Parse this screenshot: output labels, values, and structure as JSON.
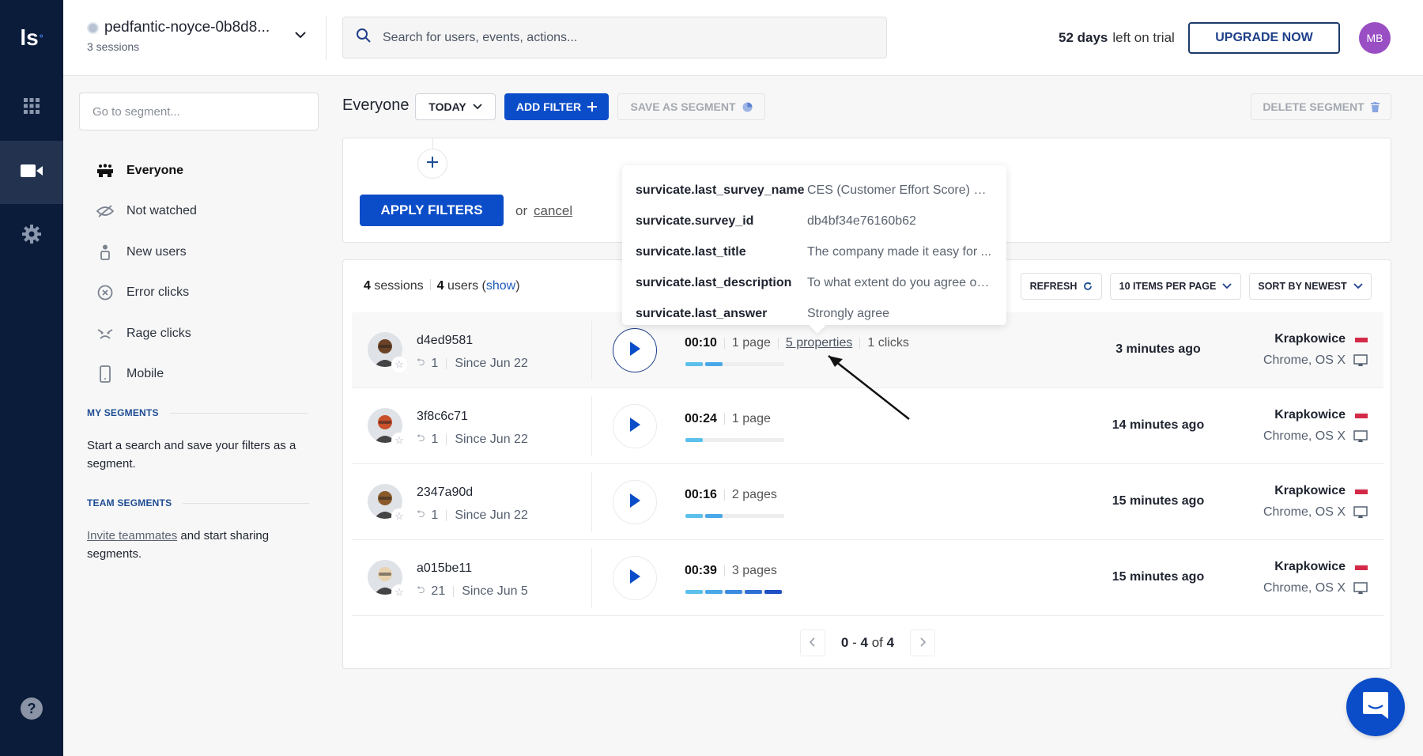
{
  "rail": {
    "logo": "ls",
    "items": [
      {
        "name": "apps",
        "icon": "grid-icon"
      },
      {
        "name": "sessions",
        "icon": "video-camera-icon",
        "active": true
      },
      {
        "name": "settings",
        "icon": "gear-icon"
      }
    ],
    "help": "?"
  },
  "header": {
    "project_name": "pedfantic-noyce-0b8d8...",
    "project_sub": "3 sessions",
    "search_placeholder": "Search for users, events, actions...",
    "trial_days": "52 days",
    "trial_text": "left on trial",
    "upgrade_label": "UPGRADE NOW",
    "avatar_initials": "MB"
  },
  "segments": {
    "search_placeholder": "Go to segment...",
    "items": [
      {
        "label": "Everyone",
        "icon": "group-icon",
        "active": true
      },
      {
        "label": "Not watched",
        "icon": "eye-off-icon"
      },
      {
        "label": "New users",
        "icon": "new-user-icon"
      },
      {
        "label": "Error clicks",
        "icon": "error-circle-icon"
      },
      {
        "label": "Rage clicks",
        "icon": "rage-face-icon"
      },
      {
        "label": "Mobile",
        "icon": "mobile-icon"
      }
    ],
    "my_title": "MY SEGMENTS",
    "my_text": "Start a search and save your filters as a segment.",
    "team_title": "TEAM SEGMENTS",
    "team_link": "Invite teammates",
    "team_text": " and start sharing segments."
  },
  "toolbar": {
    "title": "Everyone",
    "date_label": "TODAY",
    "add_filter_label": "ADD FILTER",
    "save_segment_label": "SAVE AS SEGMENT",
    "delete_segment_label": "DELETE SEGMENT"
  },
  "filters": {
    "apply_label": "APPLY FILTERS",
    "or_text": "or",
    "cancel_label": "cancel"
  },
  "sessions": {
    "count": "4",
    "count_label": "sessions",
    "users": "4",
    "users_label": "users",
    "show_label": "show",
    "refresh_label": "REFRESH",
    "per_page_label": "10 ITEMS PER PAGE",
    "sort_label": "SORT BY NEWEST",
    "rows": [
      {
        "id": "d4ed9581",
        "visits": "1",
        "since": "Since Jun 22",
        "duration": "00:10",
        "pages": "1 page",
        "properties": "5 properties",
        "clicks": "1 clicks",
        "progress_segments": 2,
        "ago": "3 minutes ago",
        "city": "Krapkowice",
        "device": "Chrome, OS X",
        "avatar_color": "#6b4226",
        "highlighted": true
      },
      {
        "id": "3f8c6c71",
        "visits": "1",
        "since": "Since Jun 22",
        "duration": "00:24",
        "pages": "1 page",
        "progress_segments": 1,
        "ago": "14 minutes ago",
        "city": "Krapkowice",
        "device": "Chrome, OS X",
        "avatar_color": "#c8502a"
      },
      {
        "id": "2347a90d",
        "visits": "1",
        "since": "Since Jun 22",
        "duration": "00:16",
        "pages": "2 pages",
        "progress_segments": 2,
        "ago": "15 minutes ago",
        "city": "Krapkowice",
        "device": "Chrome, OS X",
        "avatar_color": "#8a5a2b"
      },
      {
        "id": "a015be11",
        "visits": "21",
        "since": "Since Jun 5",
        "duration": "00:39",
        "pages": "3 pages",
        "progress_segments": 5,
        "ago": "15 minutes ago",
        "city": "Krapkowice",
        "device": "Chrome, OS X",
        "avatar_color": "#e8d2b0"
      }
    ],
    "pager": {
      "from": "0",
      "to": "4",
      "of_text": "of",
      "total": "4"
    }
  },
  "tooltip": {
    "rows": [
      {
        "key": "survicate.last_survey_name",
        "value": "CES (Customer Effort Score) W..."
      },
      {
        "key": "survicate.survey_id",
        "value": "db4bf34e76160b62"
      },
      {
        "key": "survicate.last_title",
        "value": "The company made it easy for ..."
      },
      {
        "key": "survicate.last_description",
        "value": "To what extent do you agree or ..."
      },
      {
        "key": "survicate.last_answer",
        "value": "Strongly agree"
      }
    ]
  },
  "colors": {
    "rail_bg": "#0b1c3a",
    "primary": "#0b4dc8",
    "progress": [
      "#5bc0eb",
      "#4aa8e8",
      "#3c8be0",
      "#2f6fd6",
      "#1f4fc4"
    ],
    "flag": "#d42a48",
    "avatar": "#9a4ec3"
  }
}
